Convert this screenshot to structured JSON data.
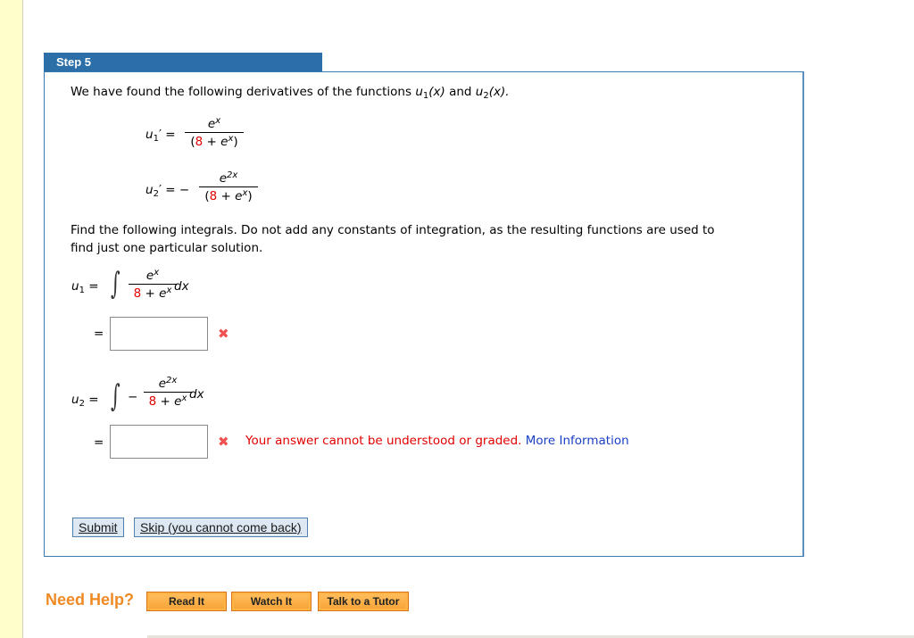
{
  "step": {
    "title": "Step 5"
  },
  "intro": {
    "text_before": "We have found the following derivatives of the functions ",
    "u1": "u",
    "u1_sub": "1",
    "arg": "(x)",
    "and": " and ",
    "u2": "u",
    "u2_sub": "2",
    "arg2": "(x).",
    "end": ""
  },
  "derivatives": [
    {
      "lhs": "u",
      "sub": "1",
      "prime": "′ =",
      "sign": "",
      "num_base": "e",
      "num_exp": "x",
      "den_open": "(",
      "den_const": "8",
      "den_rest": " + e",
      "den_exp": "x",
      "den_close": ")"
    },
    {
      "lhs": "u",
      "sub": "2",
      "prime": "′ =",
      "sign": "−",
      "num_base": "e",
      "num_exp": "2x",
      "den_open": "(",
      "den_const": "8",
      "den_rest": " + e",
      "den_exp": "x",
      "den_close": ")"
    }
  ],
  "instructions": {
    "line1": "Find the following integrals. Do not add any constants of integration, as the resulting functions are used to",
    "line2": "find just one particular solution."
  },
  "integrals": [
    {
      "lhs": "u",
      "sub": "1",
      "eq": "=",
      "sign": "",
      "num_base": "e",
      "num_exp": "x",
      "den_const": "8",
      "den_rest": " + e",
      "den_exp": "x",
      "dx": "dx",
      "answer_eq": "=",
      "answer_value": "",
      "status": "incorrect"
    },
    {
      "lhs": "u",
      "sub": "2",
      "eq": "=",
      "sign": "−",
      "num_base": "e",
      "num_exp": "2x",
      "den_const": "8",
      "den_rest": " + e",
      "den_exp": "x",
      "dx": "dx",
      "answer_eq": "=",
      "answer_value": "",
      "status": "incorrect"
    }
  ],
  "error": {
    "message": "Your answer cannot be understood or graded.",
    "link": "More Information"
  },
  "buttons": {
    "submit": "Submit",
    "skip": "Skip (you cannot come back)"
  },
  "help": {
    "label": "Need Help?",
    "read_it": "Read It",
    "watch_it": "Watch It",
    "talk_to_tutor": "Talk to a Tutor"
  },
  "colors": {
    "header_blue": "#2b6ea8",
    "error_red": "#e00000",
    "link_blue": "#1a3fc4",
    "help_orange": "#f08a24",
    "side_yellow": "#ffffcc"
  }
}
